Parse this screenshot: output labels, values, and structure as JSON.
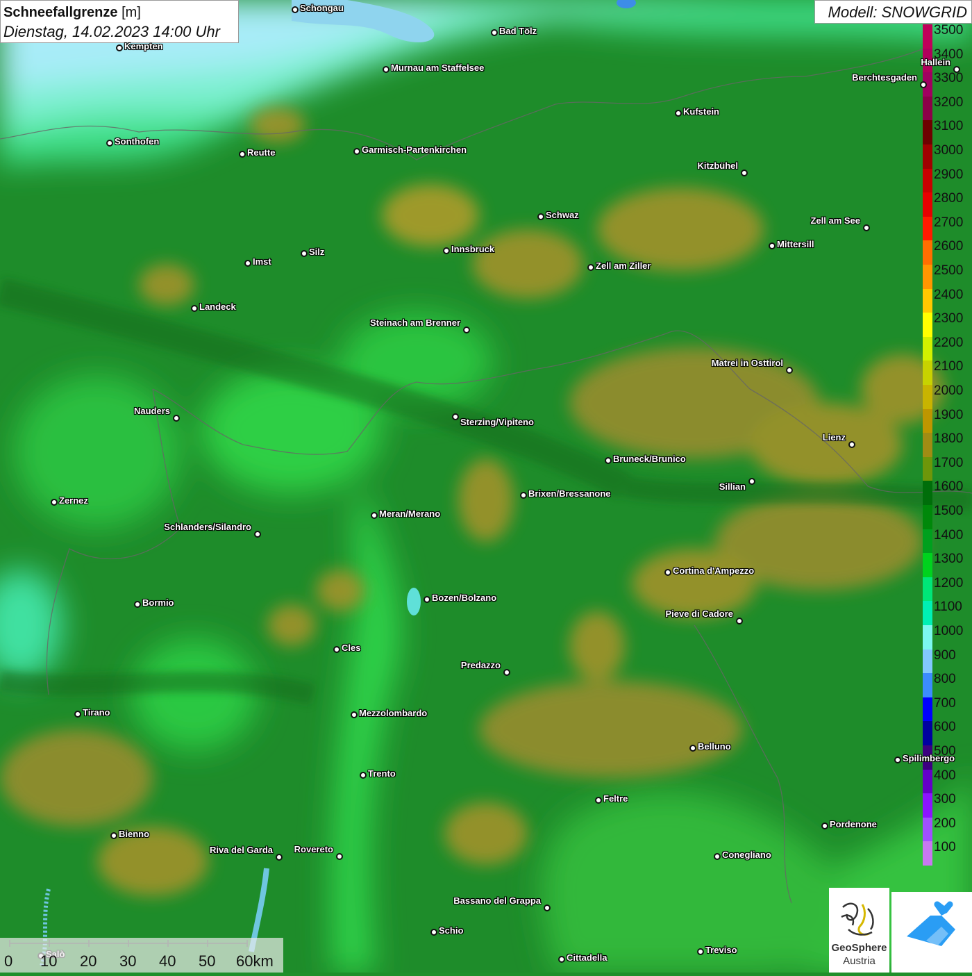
{
  "header": {
    "title": "Schneefallgrenze",
    "unit": "[m]",
    "datetime": "Dienstag, 14.02.2023 14:00 Uhr",
    "model": "Modell: SNOWGRID"
  },
  "legend": {
    "entries": [
      {
        "value": "3500",
        "color": "#c0005a"
      },
      {
        "value": "3400",
        "color": "#b0005c"
      },
      {
        "value": "3300",
        "color": "#a00060"
      },
      {
        "value": "3200",
        "color": "#8c0048"
      },
      {
        "value": "3100",
        "color": "#6e0000"
      },
      {
        "value": "3000",
        "color": "#a00000"
      },
      {
        "value": "2900",
        "color": "#c80000"
      },
      {
        "value": "2800",
        "color": "#e60000"
      },
      {
        "value": "2700",
        "color": "#ff1a00"
      },
      {
        "value": "2600",
        "color": "#ff6e00"
      },
      {
        "value": "2500",
        "color": "#ff9600"
      },
      {
        "value": "2400",
        "color": "#ffc800"
      },
      {
        "value": "2300",
        "color": "#ffff00"
      },
      {
        "value": "2200",
        "color": "#d2f000"
      },
      {
        "value": "2100",
        "color": "#c8d200"
      },
      {
        "value": "2000",
        "color": "#c8b400"
      },
      {
        "value": "1900",
        "color": "#be9600"
      },
      {
        "value": "1800",
        "color": "#a08c14"
      },
      {
        "value": "1700",
        "color": "#6e960a"
      },
      {
        "value": "1600",
        "color": "#006e0a"
      },
      {
        "value": "1500",
        "color": "#00880a"
      },
      {
        "value": "1400",
        "color": "#00a01e"
      },
      {
        "value": "1300",
        "color": "#00d21e"
      },
      {
        "value": "1200",
        "color": "#00e678"
      },
      {
        "value": "1100",
        "color": "#00f0b4"
      },
      {
        "value": "1000",
        "color": "#7cf8f0"
      },
      {
        "value": "900",
        "color": "#82c8ff"
      },
      {
        "value": "800",
        "color": "#3c8cff"
      },
      {
        "value": "700",
        "color": "#0000ff"
      },
      {
        "value": "600",
        "color": "#0000a0"
      },
      {
        "value": "500",
        "color": "#3c0080"
      },
      {
        "value": "400",
        "color": "#6400c8"
      },
      {
        "value": "300",
        "color": "#8c14ff"
      },
      {
        "value": "200",
        "color": "#a050ff"
      },
      {
        "value": "100",
        "color": "#c878f0"
      }
    ]
  },
  "cities": [
    "Schongau",
    "Kempten",
    "Bad Tölz",
    "Murnau am Staffelsee",
    "Sonthofen",
    "Reutte",
    "Garmisch-Partenkirchen",
    "Kufstein",
    "Berchtesgaden",
    "Hallein",
    "Kitzbühel",
    "Schwaz",
    "Zell am See",
    "Mittersill",
    "Innsbruck",
    "Zell am Ziller",
    "Imst",
    "Silz",
    "Landeck",
    "Steinach am Brenner",
    "Matrei in Osttirol",
    "Nauders",
    "Sterzing/Vipiteno",
    "Lienz",
    "Bruneck/Brunico",
    "Sillian",
    "Zernez",
    "Brixen/Bressanone",
    "Meran/Merano",
    "Schlanders/Silandro",
    "Cortina d'Ampezzo",
    "Bozen/Bolzano",
    "Bormio",
    "Pieve di Cadore",
    "Cles",
    "Predazzo",
    "Tirano",
    "Mezzolombardo",
    "Belluno",
    "Spilimbergo",
    "Trento",
    "Feltre",
    "Pordenone",
    "Bienno",
    "Riva del Garda",
    "Rovereto",
    "Conegliano",
    "Bassano del Grappa",
    "Schio",
    "Treviso",
    "Cittadella",
    "Salò"
  ],
  "scale": {
    "labels": [
      "0",
      "10",
      "20",
      "30",
      "40",
      "50",
      "60km"
    ]
  },
  "logo": {
    "line1": "GeoSphere",
    "line2": "Austria"
  }
}
